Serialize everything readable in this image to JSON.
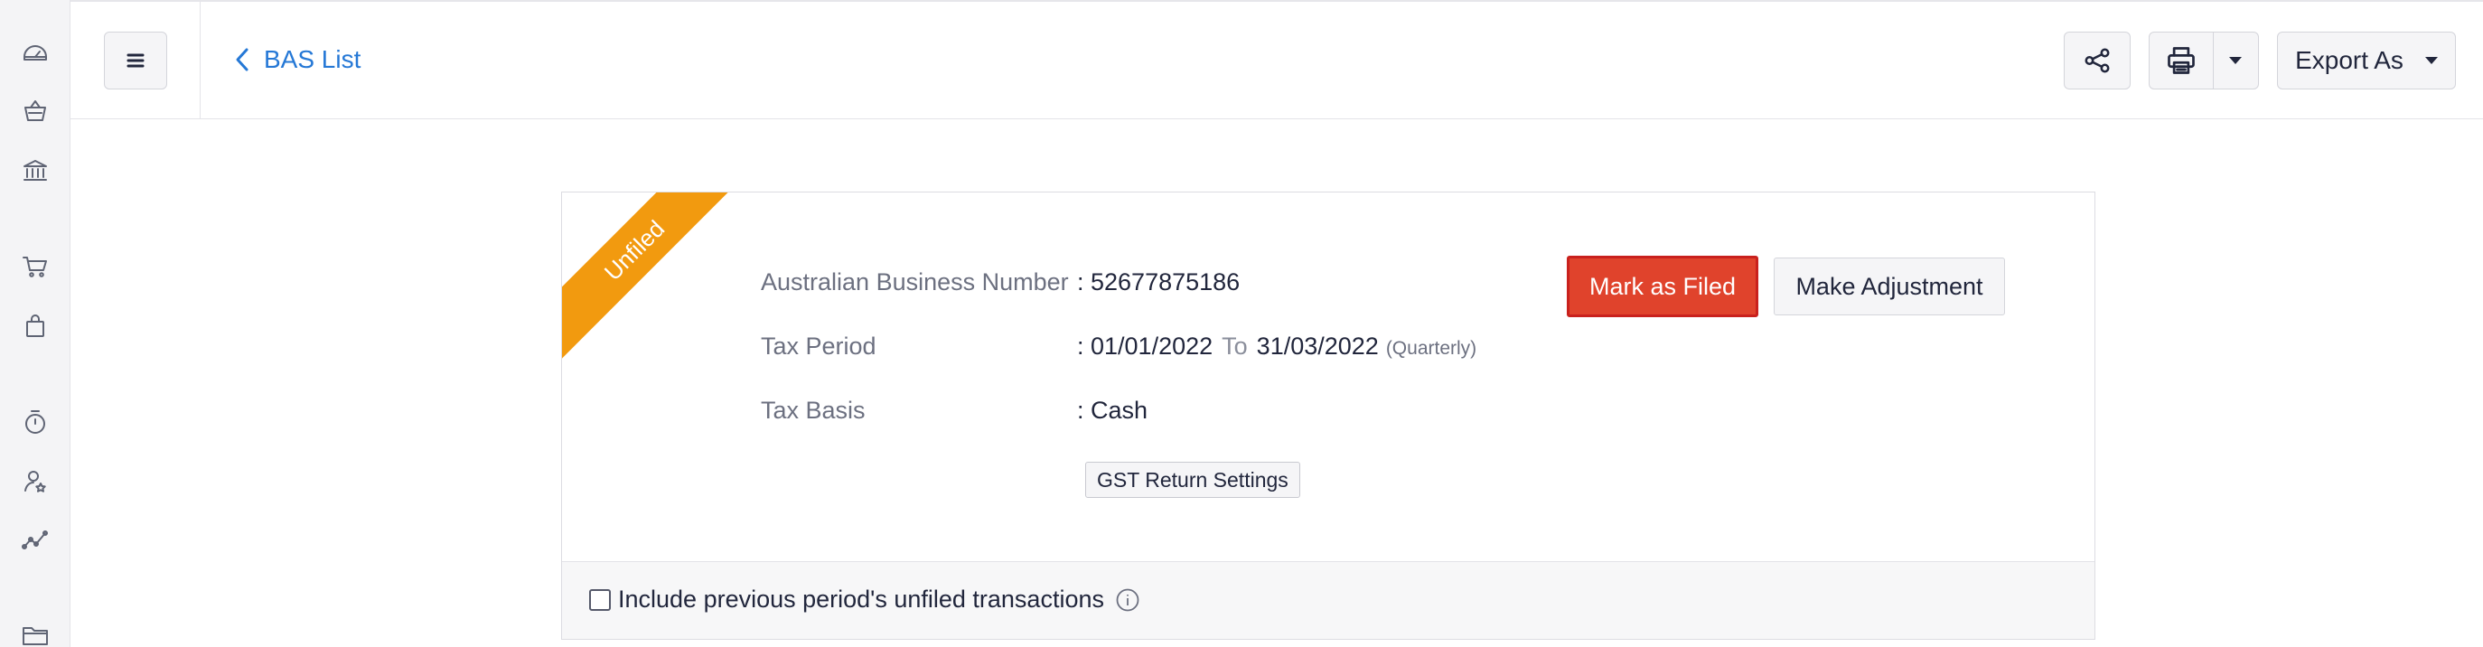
{
  "rail": {
    "icons": [
      "dashboard-icon",
      "items-basket-icon",
      "banking-icon",
      "sales-cart-icon",
      "purchases-bag-icon",
      "time-tracking-icon",
      "accountant-icon",
      "reports-icon",
      "documents-icon"
    ]
  },
  "header": {
    "back_label": "BAS List",
    "export_label": "Export As"
  },
  "status": {
    "ribbon_label": "Unfiled",
    "ribbon_color": "#f29a0f"
  },
  "details": {
    "abn_label": "Australian Business Number",
    "abn_value": ": 52677875186",
    "period_label": "Tax Period",
    "period_start": ": 01/01/2022",
    "period_to": "To",
    "period_end": "31/03/2022",
    "period_type": "(Quarterly)",
    "basis_label": "Tax Basis",
    "basis_value": ": Cash"
  },
  "actions": {
    "gst_settings_label": "GST Return Settings",
    "mark_filed_label": "Mark as Filed",
    "make_adjustment_label": "Make Adjustment",
    "mark_filed_color": "#e0432c"
  },
  "footer": {
    "include_unfiled_label": "Include previous period's unfiled transactions",
    "include_unfiled_checked": false
  },
  "colors": {
    "link": "#2578d6"
  }
}
